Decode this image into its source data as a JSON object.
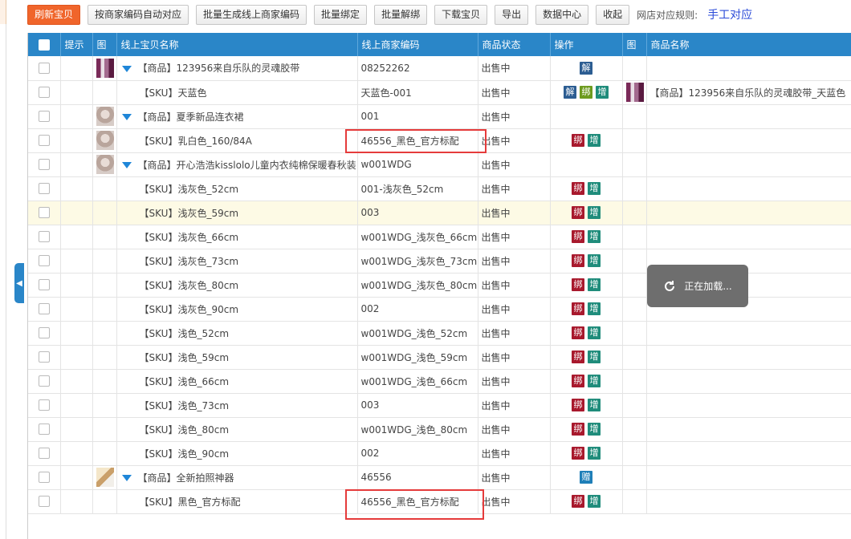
{
  "toolbar": {
    "refresh": "刷新宝贝",
    "auto_match": "按商家编码自动对应",
    "batch_generate": "批量生成线上商家编码",
    "batch_bind": "批量绑定",
    "batch_unbind": "批量解绑",
    "download": "下载宝贝",
    "export": "导出",
    "data_center": "数据中心",
    "collapse": "收起",
    "rule_label": "网店对应规则:",
    "rule_link": "手工对应"
  },
  "columns": [
    "",
    "提示",
    "图",
    "线上宝贝名称",
    "线上商家编码",
    "商品状态",
    "操作",
    "图",
    "商品名称"
  ],
  "loading_text": "正在加载...",
  "colors": {
    "header": "#2a86c8",
    "accent": "#f0652b",
    "bind": "#a8192d",
    "add": "#1f8c7b",
    "unbind": "#2c5d92"
  },
  "rows": [
    {
      "name": "【商品】123956来自乐队的灵魂胶带",
      "code": "08252262",
      "status": "出售中",
      "ops": [
        "解"
      ],
      "product": ""
    },
    {
      "name": "【SKU】天蓝色",
      "code": "天蓝色-001",
      "status": "出售中",
      "ops": [
        "解",
        "绑",
        "增"
      ],
      "product": "【商品】123956来自乐队的灵魂胶带_天蓝色"
    },
    {
      "name": "【商品】夏季新品连衣裙",
      "code": "001",
      "status": "出售中",
      "ops": [],
      "product": ""
    },
    {
      "name": "【SKU】乳白色_160/84A",
      "code": "46556_黑色_官方标配",
      "status": "出售中",
      "ops": [
        "绑",
        "增"
      ],
      "product": ""
    },
    {
      "name": "【商品】开心浩浩kisslolo儿童内衣纯棉保暖春秋装",
      "code": "w001WDG",
      "status": "出售中",
      "ops": [],
      "product": ""
    },
    {
      "name": "【SKU】浅灰色_52cm",
      "code": "001-浅灰色_52cm",
      "status": "出售中",
      "ops": [
        "绑",
        "增"
      ],
      "product": ""
    },
    {
      "name": "【SKU】浅灰色_59cm",
      "code": "003",
      "status": "出售中",
      "ops": [
        "绑",
        "增"
      ],
      "product": ""
    },
    {
      "name": "【SKU】浅灰色_66cm",
      "code": "w001WDG_浅灰色_66cm",
      "status": "出售中",
      "ops": [
        "绑",
        "增"
      ],
      "product": ""
    },
    {
      "name": "【SKU】浅灰色_73cm",
      "code": "w001WDG_浅灰色_73cm",
      "status": "出售中",
      "ops": [
        "绑",
        "增"
      ],
      "product": ""
    },
    {
      "name": "【SKU】浅灰色_80cm",
      "code": "w001WDG_浅灰色_80cm",
      "status": "出售中",
      "ops": [
        "绑",
        "增"
      ],
      "product": ""
    },
    {
      "name": "【SKU】浅灰色_90cm",
      "code": "002",
      "status": "出售中",
      "ops": [
        "绑",
        "增"
      ],
      "product": ""
    },
    {
      "name": "【SKU】浅色_52cm",
      "code": "w001WDG_浅色_52cm",
      "status": "出售中",
      "ops": [
        "绑",
        "增"
      ],
      "product": ""
    },
    {
      "name": "【SKU】浅色_59cm",
      "code": "w001WDG_浅色_59cm",
      "status": "出售中",
      "ops": [
        "绑",
        "增"
      ],
      "product": ""
    },
    {
      "name": "【SKU】浅色_66cm",
      "code": "w001WDG_浅色_66cm",
      "status": "出售中",
      "ops": [
        "绑",
        "增"
      ],
      "product": ""
    },
    {
      "name": "【SKU】浅色_73cm",
      "code": "003",
      "status": "出售中",
      "ops": [
        "绑",
        "增"
      ],
      "product": ""
    },
    {
      "name": "【SKU】浅色_80cm",
      "code": "w001WDG_浅色_80cm",
      "status": "出售中",
      "ops": [
        "绑",
        "增"
      ],
      "product": ""
    },
    {
      "name": "【SKU】浅色_90cm",
      "code": "002",
      "status": "出售中",
      "ops": [
        "绑",
        "增"
      ],
      "product": ""
    },
    {
      "name": "【商品】全新拍照神器",
      "code": "46556",
      "status": "出售中",
      "ops": [
        "赠"
      ],
      "product": ""
    },
    {
      "name": "【SKU】黑色_官方标配",
      "code": "46556_黑色_官方标配",
      "status": "出售中",
      "ops": [
        "绑",
        "增"
      ],
      "product": ""
    }
  ]
}
